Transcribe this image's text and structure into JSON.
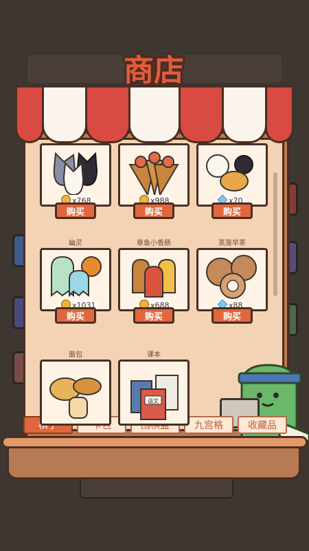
{
  "shop": {
    "title": "商店"
  },
  "items": [
    {
      "name": "",
      "price": "x768",
      "currency": "coin",
      "buy_label": "购买"
    },
    {
      "name": "",
      "price": "x988",
      "currency": "coin",
      "buy_label": "购买"
    },
    {
      "name": "",
      "price": "x70",
      "currency": "gem",
      "buy_label": "购买"
    },
    {
      "name": "幽灵",
      "price": "x1031",
      "currency": "coin",
      "buy_label": "购买"
    },
    {
      "name": "章鱼小香肠",
      "price": "x688",
      "currency": "coin",
      "buy_label": "购买"
    },
    {
      "name": "蒸笼早茶",
      "price": "x88",
      "currency": "gem",
      "buy_label": "购买"
    },
    {
      "name": "面包",
      "price": "",
      "currency": "",
      "buy_label": ""
    },
    {
      "name": "课本",
      "price": "",
      "currency": "",
      "buy_label": ""
    }
  ],
  "book_tag": "语文",
  "tabs": [
    {
      "label": "棋子",
      "active": true
    },
    {
      "label": "卡包",
      "active": false
    },
    {
      "label": "围棋盘",
      "active": false
    },
    {
      "label": "九宫格",
      "active": false
    },
    {
      "label": "收藏品",
      "active": false
    }
  ],
  "colors": {
    "accent": "#e0673c",
    "awning_red": "#d94a43",
    "panel": "#f4d3b4",
    "outline": "#4a2e22"
  }
}
